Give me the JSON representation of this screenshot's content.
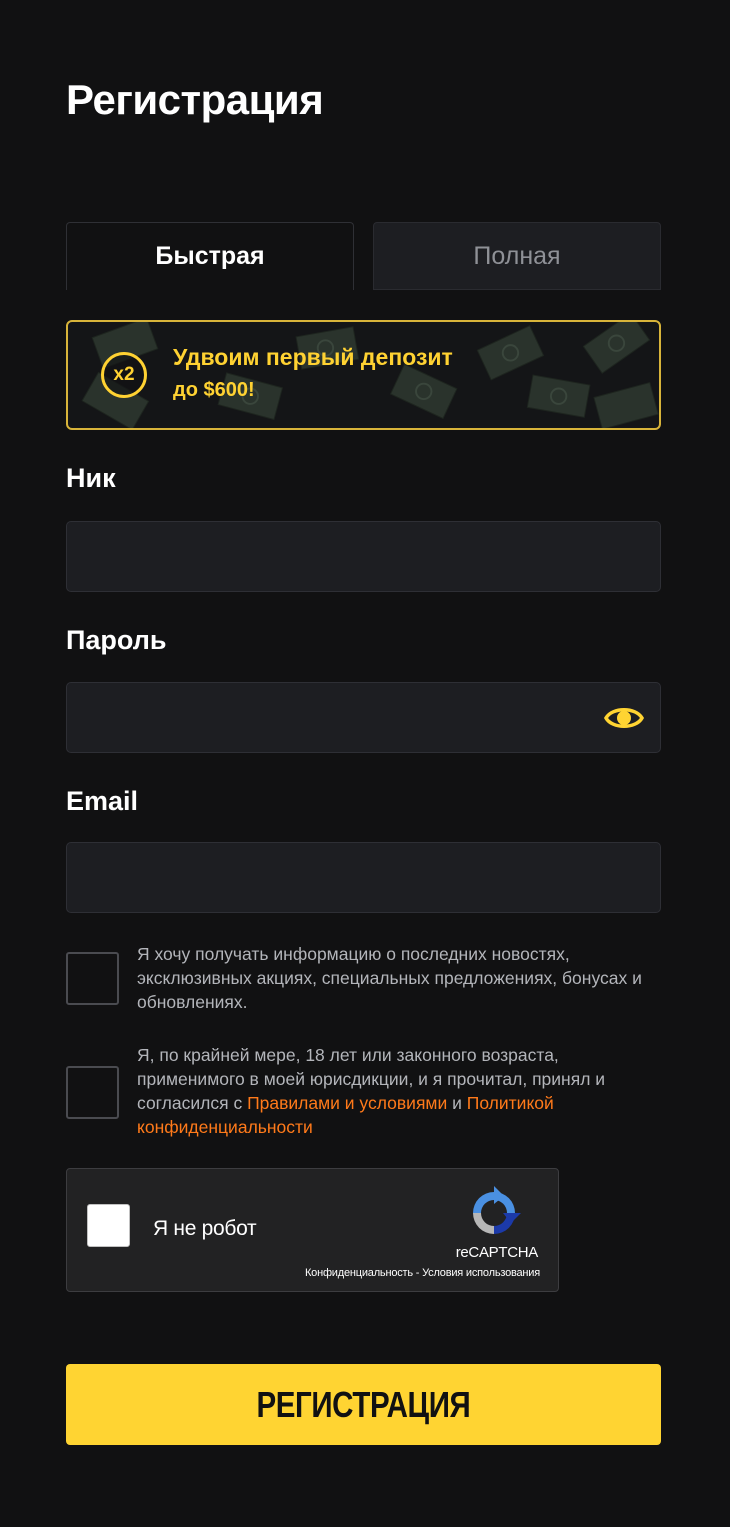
{
  "page": {
    "title": "Регистрация"
  },
  "tabs": [
    {
      "label": "Быстрая",
      "active": true
    },
    {
      "label": "Полная",
      "active": false
    }
  ],
  "promo": {
    "badge": "x2",
    "title": "Удвоим первый депозит",
    "subtitle": "до $600!"
  },
  "form": {
    "nickname_label": "Ник",
    "nickname_value": "",
    "password_label": "Пароль",
    "password_value": "",
    "email_label": "Email",
    "email_value": ""
  },
  "consents": {
    "newsletter_text": "Я хочу получать информацию о последних новостях, эксклюзивных акциях, специальных предложениях, бонусах и обновлениях.",
    "age_text_part1": "Я, по крайней мере, 18 лет или законного возраста, применимого в моей юрисдикции, и я прочитал, принял и согласился с ",
    "terms_link": "Правилами и условиями",
    "age_text_part2": " и ",
    "privacy_link": "Политикой конфиденциальности"
  },
  "captcha": {
    "label": "Я не робот",
    "brand": "reCAPTCHA",
    "privacy": "Конфиденциальность",
    "separator": " - ",
    "terms": "Условия использования"
  },
  "submit": {
    "label": "РЕГИСТРАЦИЯ"
  },
  "colors": {
    "background": "#111112",
    "accent": "#ffd432",
    "link": "#ff7a1a",
    "field": "#1d1e22"
  },
  "icons": {
    "password_toggle": "eye-icon",
    "captcha_logo": "recaptcha-logo-icon"
  }
}
